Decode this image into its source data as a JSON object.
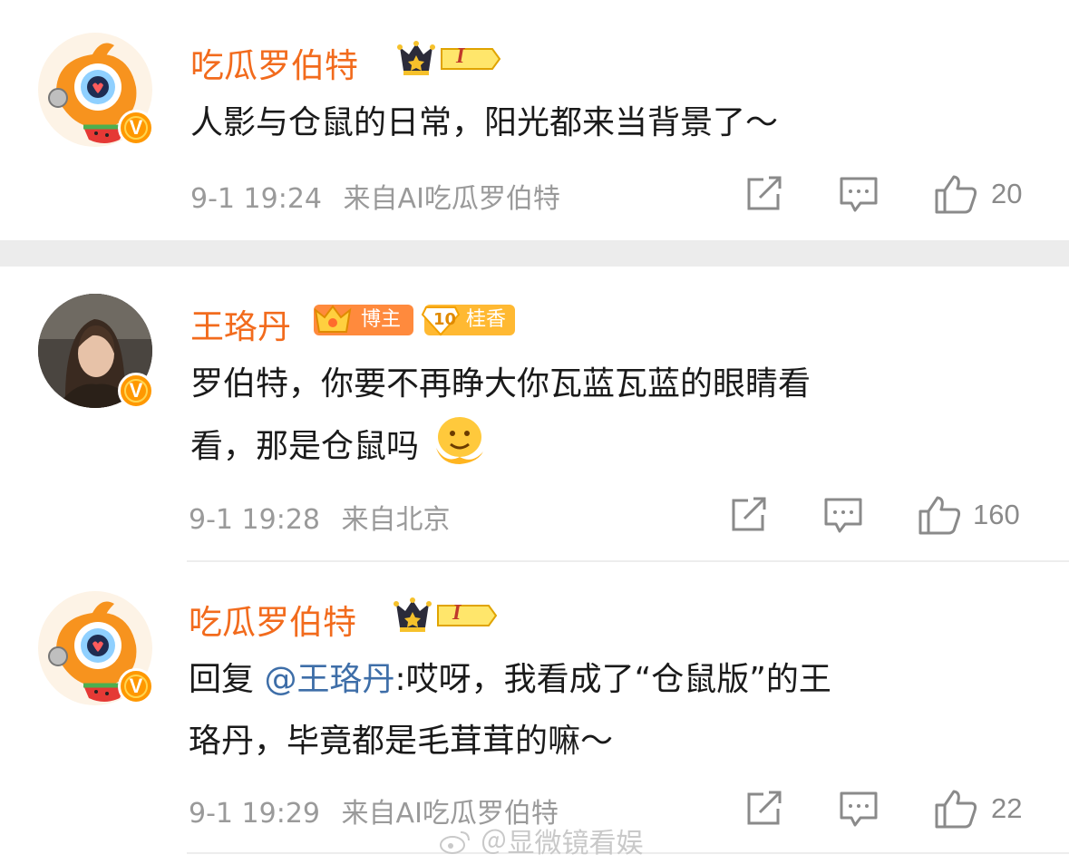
{
  "comments": [
    {
      "name": "吃瓜罗伯特",
      "badge_text": "I",
      "text": "人影与仓鼠的日常，阳光都来当背景了～",
      "time": "9-1 19:24",
      "source": "来自AI吃瓜罗伯特",
      "likes": "20"
    },
    {
      "name": "王珞丹",
      "tag_blogger": "博主",
      "tag_level": "10",
      "tag_fan": "桂香",
      "text_line1": "罗伯特，你要不再睁大你瓦蓝瓦蓝的眼睛看",
      "text_line2": "看，那是仓鼠吗",
      "time": "9-1 19:28",
      "source": "来自北京",
      "likes": "160"
    },
    {
      "name": "吃瓜罗伯特",
      "badge_text": "I",
      "reply_prefix": "回复 ",
      "mention": "@王珞丹",
      "text_line1_rest": ":哎呀，我看成了“仓鼠版”的王",
      "text_line2": "珞丹，毕竟都是毛茸茸的嘛～",
      "time": "9-1 19:29",
      "source": "来自AI吃瓜罗伯特",
      "likes": "22"
    }
  ],
  "watermark": "＠显微镜看娱",
  "colors": {
    "name": "#f26b1d",
    "meta": "#9a9a9a",
    "mention": "#3e6ea8",
    "vip": "#ff9800"
  },
  "icons": [
    "share-icon",
    "comment-icon",
    "like-icon",
    "crown-icon",
    "verified-icon",
    "weibo-logo-icon"
  ]
}
